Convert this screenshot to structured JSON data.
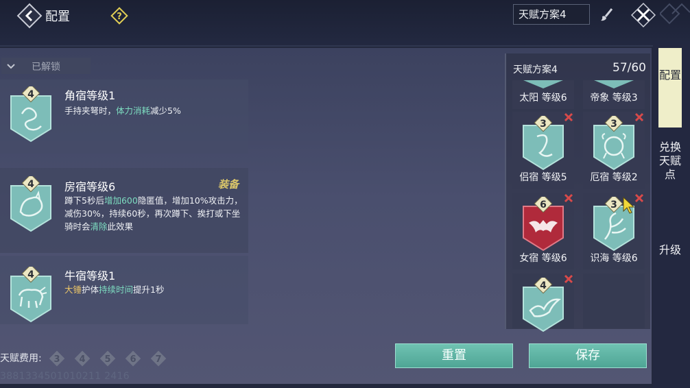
{
  "header": {
    "title": "配置",
    "scheme_field": "天赋方案4"
  },
  "unlocked": {
    "label": "已解锁"
  },
  "talents": [
    {
      "name": "角宿等级1",
      "level": "4",
      "desc": [
        {
          "t": "手持夹弩时，",
          "c": ""
        },
        {
          "t": "体力消耗",
          "c": "green"
        },
        {
          "t": "减少5%",
          "c": ""
        }
      ]
    },
    {
      "name": "房宿等级6",
      "level": "4",
      "equipped": "装备",
      "desc": [
        {
          "t": "蹲下5秒后",
          "c": ""
        },
        {
          "t": "增加600",
          "c": "green"
        },
        {
          "t": "隐匿值，增加10%攻击力，减伤30%，持续60秒，再次蹲下、挨打或下坐骑时会",
          "c": ""
        },
        {
          "t": "清除",
          "c": "green"
        },
        {
          "t": "此效果",
          "c": ""
        }
      ]
    },
    {
      "name": "牛宿等级1",
      "level": "4",
      "desc": [
        {
          "t": "大锤",
          "c": "gold"
        },
        {
          "t": "护体",
          "c": ""
        },
        {
          "t": "持续时间",
          "c": "green"
        },
        {
          "t": "提升1秒",
          "c": ""
        }
      ]
    }
  ],
  "cost": {
    "label": "天赋费用:",
    "options": [
      "3",
      "4",
      "5",
      "6",
      "7"
    ]
  },
  "uid": "3881334501010211 2416",
  "buttons": {
    "reset": "重置",
    "save": "保存"
  },
  "scheme": {
    "name": "天赋方案4",
    "count": "57/60",
    "slots": [
      {
        "label": "太阳 等级6",
        "level": "",
        "removable": false,
        "color": "teal"
      },
      {
        "label": "帝象 等级3",
        "level": "",
        "removable": false,
        "color": "teal"
      },
      {
        "label": "侣宿 等级5",
        "level": "3",
        "removable": true,
        "color": "teal"
      },
      {
        "label": "厄宿 等级2",
        "level": "3",
        "removable": true,
        "color": "teal"
      },
      {
        "label": "女宿 等级6",
        "level": "6",
        "removable": true,
        "color": "red"
      },
      {
        "label": "识海 等级6",
        "level": "3",
        "removable": true,
        "color": "teal"
      },
      {
        "label": "",
        "level": "4",
        "removable": true,
        "color": "teal"
      },
      {
        "label": "",
        "level": "",
        "removable": false,
        "color": "empty"
      }
    ]
  },
  "tabs": {
    "configure": "配置",
    "exchange": "兑换天赋点",
    "upgrade": "升级"
  },
  "colors": {
    "accent": "#6fc2b2",
    "highlight": "#7ddcc0",
    "gold": "#e7c268",
    "remove": "#d84a4a",
    "red_badge": "#b02a3b"
  }
}
